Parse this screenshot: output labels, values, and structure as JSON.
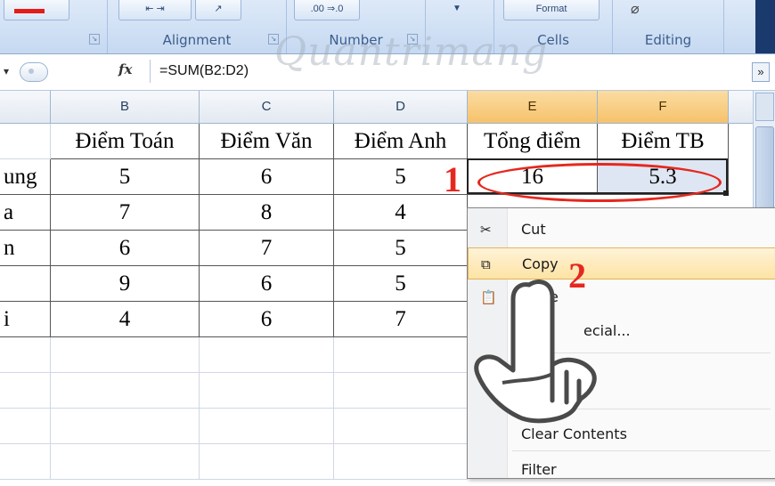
{
  "ribbon": {
    "groups": [
      {
        "label": "Alignment"
      },
      {
        "label": "Number"
      },
      {
        "label": "Cells"
      },
      {
        "label": "Editing"
      }
    ],
    "number_format_buttons": ".00 ⇒.0",
    "cells_format_label": "Format"
  },
  "formula_bar": {
    "fx_label": "fx",
    "formula": "=SUM(B2:D2)"
  },
  "watermark": "Quantrimang",
  "grid": {
    "columns": [
      "B",
      "C",
      "D",
      "E",
      "F"
    ],
    "headers_row": [
      "Điểm Toán",
      "Điểm Văn",
      "Điểm Anh",
      "Tổng điểm",
      "Điểm TB"
    ],
    "rows": [
      {
        "name": "ung",
        "b": "5",
        "c": "6",
        "d": "5",
        "e": "16",
        "f": "5.3"
      },
      {
        "name": "a",
        "b": "7",
        "c": "8",
        "d": "4"
      },
      {
        "name": "n",
        "b": "6",
        "c": "7",
        "d": "5"
      },
      {
        "name": "",
        "b": "9",
        "c": "6",
        "d": "5"
      },
      {
        "name": "i",
        "b": "4",
        "c": "6",
        "d": "7"
      }
    ]
  },
  "annotations": {
    "step1": "1",
    "step2": "2"
  },
  "context_menu": {
    "items": [
      {
        "label": "Cut",
        "icon": "scissors-icon"
      },
      {
        "label": "Copy",
        "icon": "copy-icon"
      },
      {
        "label": "e",
        "icon": "paste-icon"
      },
      {
        "label": "ecial..."
      },
      {
        "label": "Clear Contents"
      },
      {
        "label": "Filter"
      }
    ]
  },
  "colors": {
    "accent_red": "#e5281e",
    "selected_header": "#f6c26b",
    "ribbon": "#c6d9f1"
  }
}
